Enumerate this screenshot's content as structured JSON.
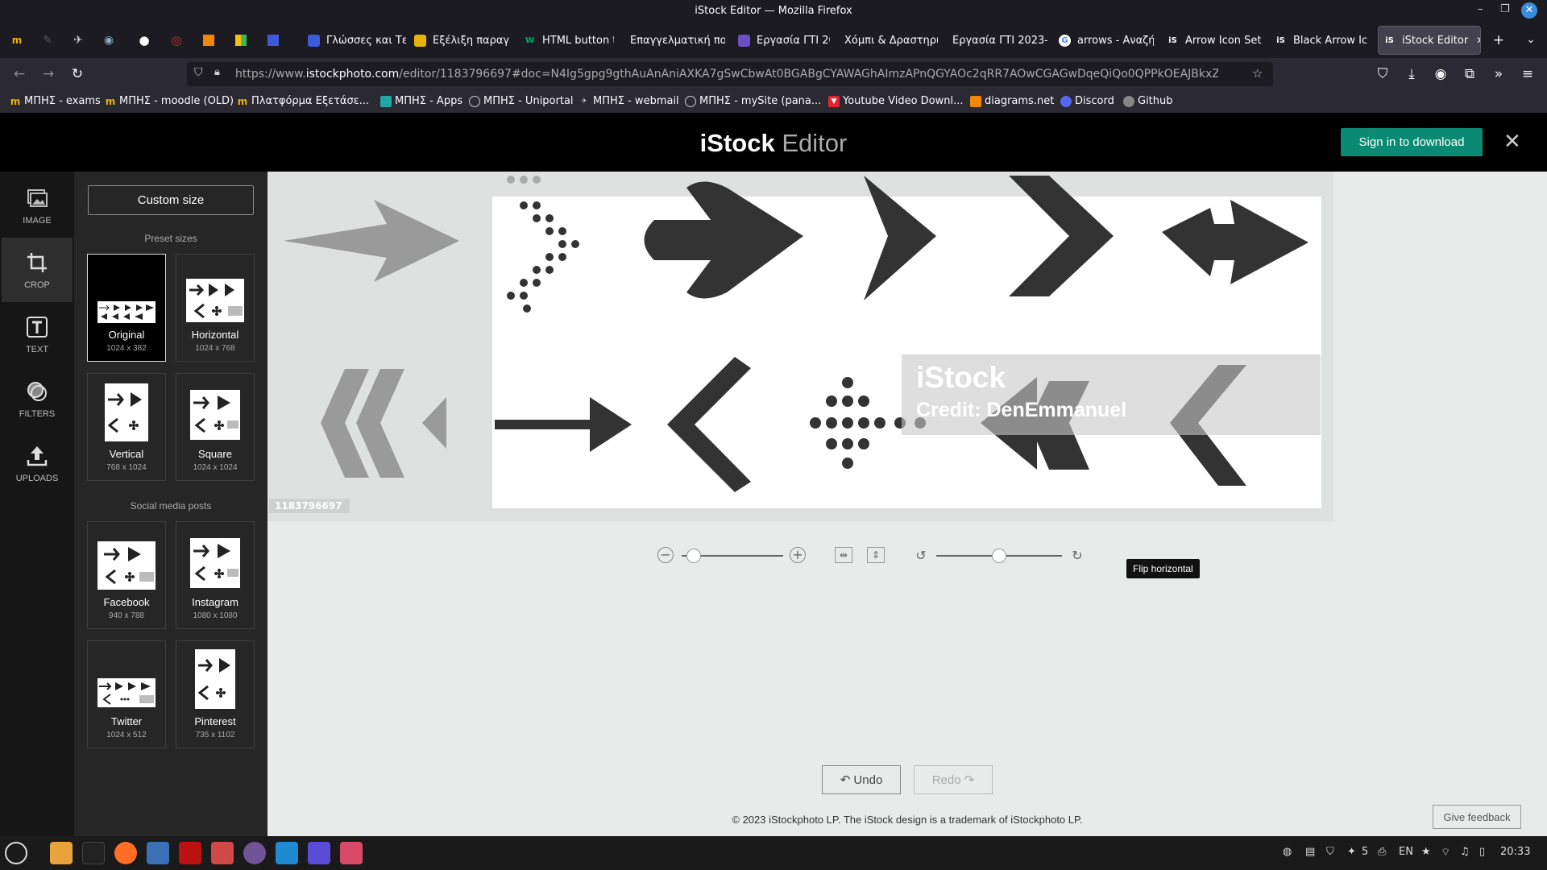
{
  "window": {
    "title": "iStock Editor — Mozilla Firefox"
  },
  "tabs": [
    {
      "label": "Γλώσσες και Τε",
      "icon": "doc-icon",
      "color": "#3b5bdb"
    },
    {
      "label": "Εξέλιξη παραγω",
      "icon": "edge-icon",
      "color": "#e8b40a"
    },
    {
      "label": "HTML button t",
      "icon": "w3-icon",
      "color": "#04aa6d"
    },
    {
      "label": "Επαγγελματική πο",
      "icon": "none",
      "color": "#1c1b22"
    },
    {
      "label": "Εργασία ΓΤΙ 20",
      "icon": "list-icon",
      "color": "#6a4fc6"
    },
    {
      "label": "Χόμπι & Δραστηρι",
      "icon": "none",
      "color": "#1c1b22"
    },
    {
      "label": "Εργασία ΓΤΙ 2023-",
      "icon": "none",
      "color": "#1c1b22"
    },
    {
      "label": "arrows - Αναζή",
      "icon": "google-icon",
      "color": "#ffffff"
    },
    {
      "label": "Arrow Icon Set",
      "icon": "istock-icon",
      "color": "#1c1b22"
    },
    {
      "label": "Black Arrow Ic",
      "icon": "istock-icon",
      "color": "#1c1b22"
    },
    {
      "label": "iStock Editor",
      "icon": "istock-icon",
      "color": "#1c1b22"
    }
  ],
  "url": {
    "prefix": "https://www.",
    "domain": "istockphoto.com",
    "rest": "/editor/1183796697#doc=N4Ig5gpg9gthAuAnAniAXKA7gSwCbwAt0BGABgCYAWAGhAImzAPnQGYAOc2qRR7AOwCGAGwDqeQiQo0QPPkOEAJBkxZoO5AL7cARgCsIAY"
  },
  "bookmarks": [
    {
      "label": "ΜΠΗΣ - exams",
      "color": "#e8b40a"
    },
    {
      "label": "ΜΠΗΣ - moodle (OLD)",
      "color": "#e8b40a"
    },
    {
      "label": "Πλατφόρμα Εξετάσε...",
      "color": "#e8b40a"
    },
    {
      "label": "ΜΠΗΣ - Apps",
      "color": "#22a6a6"
    },
    {
      "label": "ΜΠΗΣ - Uniportal",
      "color": "#888888"
    },
    {
      "label": "ΜΠΗΣ - webmail",
      "color": "#888888"
    },
    {
      "label": "ΜΠΗΣ - mySite (pana...",
      "color": "#888888"
    },
    {
      "label": "Youtube Video Downl...",
      "color": "#e0242c"
    },
    {
      "label": "diagrams.net",
      "color": "#f08705"
    },
    {
      "label": "Discord",
      "color": "#5865f2"
    },
    {
      "label": "Github",
      "color": "#888888"
    }
  ],
  "header": {
    "brand_bold": "iStock",
    "brand_light": " Editor",
    "signin": "Sign in to download",
    "close": "✕"
  },
  "rail": [
    {
      "label": "IMAGE"
    },
    {
      "label": "CROP"
    },
    {
      "label": "TEXT"
    },
    {
      "label": "FILTERS"
    },
    {
      "label": "UPLOADS"
    }
  ],
  "panel": {
    "custom_size": "Custom size",
    "preset_heading": "Preset sizes",
    "social_heading": "Social media posts",
    "presets": [
      {
        "name": "Original",
        "dims": "1024 x 382"
      },
      {
        "name": "Horizontal",
        "dims": "1024 x 768"
      },
      {
        "name": "Vertical",
        "dims": "768 x 1024"
      },
      {
        "name": "Square",
        "dims": "1024 x 1024"
      }
    ],
    "social": [
      {
        "name": "Facebook",
        "dims": "940 x 788"
      },
      {
        "name": "Instagram",
        "dims": "1080 x 1080"
      },
      {
        "name": "Twitter",
        "dims": "1024 x 512"
      },
      {
        "name": "Pinterest",
        "dims": "735 x 1102"
      }
    ]
  },
  "canvas": {
    "image_id": "1183796697",
    "watermark_brand": "iStock",
    "watermark_credit": "Credit: DenEmmanuel"
  },
  "controls": {
    "tooltip": "Flip horizontal",
    "zoom_level": 0.12,
    "rotation_level": 0.5
  },
  "actions": {
    "undo": "↶ Undo",
    "redo": "Redo ↷",
    "feedback": "Give feedback"
  },
  "footer": {
    "copyright": "© 2023 iStockphoto LP. The iStock design is a trademark of iStockphoto LP."
  },
  "taskbar": {
    "time": "20:33",
    "lang": "EN",
    "badge_count": "5"
  }
}
